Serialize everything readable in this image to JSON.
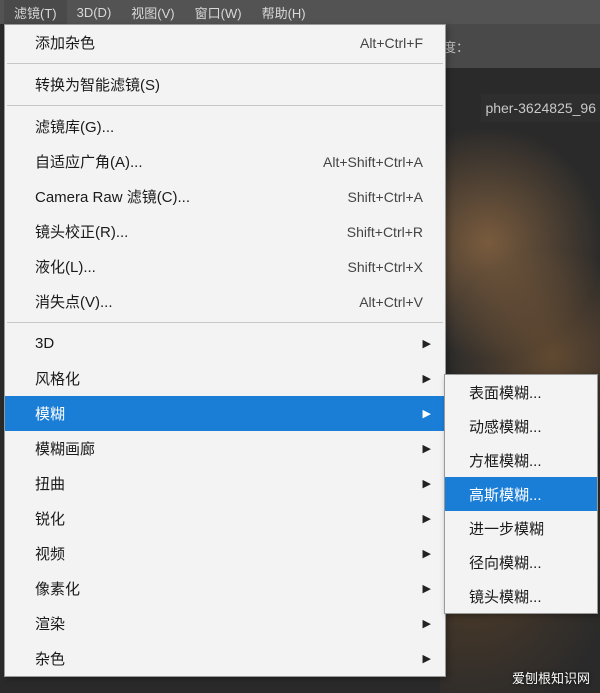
{
  "menubar": {
    "items": [
      {
        "label": "滤镜(T)"
      },
      {
        "label": "3D(D)"
      },
      {
        "label": "视图(V)"
      },
      {
        "label": "窗口(W)"
      },
      {
        "label": "帮助(H)"
      }
    ]
  },
  "optionsbar": {
    "height_label": "高度："
  },
  "tab": {
    "filename": "pher-3624825_96"
  },
  "filter_menu": {
    "items": [
      {
        "label": "添加杂色",
        "shortcut": "Alt+Ctrl+F"
      },
      {
        "sep": true
      },
      {
        "label": "转换为智能滤镜(S)"
      },
      {
        "sep": true
      },
      {
        "label": "滤镜库(G)..."
      },
      {
        "label": "自适应广角(A)...",
        "shortcut": "Alt+Shift+Ctrl+A"
      },
      {
        "label": "Camera Raw 滤镜(C)...",
        "shortcut": "Shift+Ctrl+A"
      },
      {
        "label": "镜头校正(R)...",
        "shortcut": "Shift+Ctrl+R"
      },
      {
        "label": "液化(L)...",
        "shortcut": "Shift+Ctrl+X"
      },
      {
        "label": "消失点(V)...",
        "shortcut": "Alt+Ctrl+V"
      },
      {
        "sep": true
      },
      {
        "label": "3D",
        "submenu": true
      },
      {
        "label": "风格化",
        "submenu": true
      },
      {
        "label": "模糊",
        "submenu": true,
        "highlight": true
      },
      {
        "label": "模糊画廊",
        "submenu": true
      },
      {
        "label": "扭曲",
        "submenu": true
      },
      {
        "label": "锐化",
        "submenu": true
      },
      {
        "label": "视频",
        "submenu": true
      },
      {
        "label": "像素化",
        "submenu": true
      },
      {
        "label": "渲染",
        "submenu": true
      },
      {
        "label": "杂色",
        "submenu": true
      }
    ]
  },
  "blur_submenu": {
    "items": [
      {
        "label": "表面模糊..."
      },
      {
        "label": "动感模糊..."
      },
      {
        "label": "方框模糊..."
      },
      {
        "label": "高斯模糊...",
        "highlight": true
      },
      {
        "label": "进一步模糊"
      },
      {
        "label": "径向模糊..."
      },
      {
        "label": "镜头模糊..."
      }
    ]
  },
  "watermark": {
    "line1": "爱刨根知识网"
  }
}
